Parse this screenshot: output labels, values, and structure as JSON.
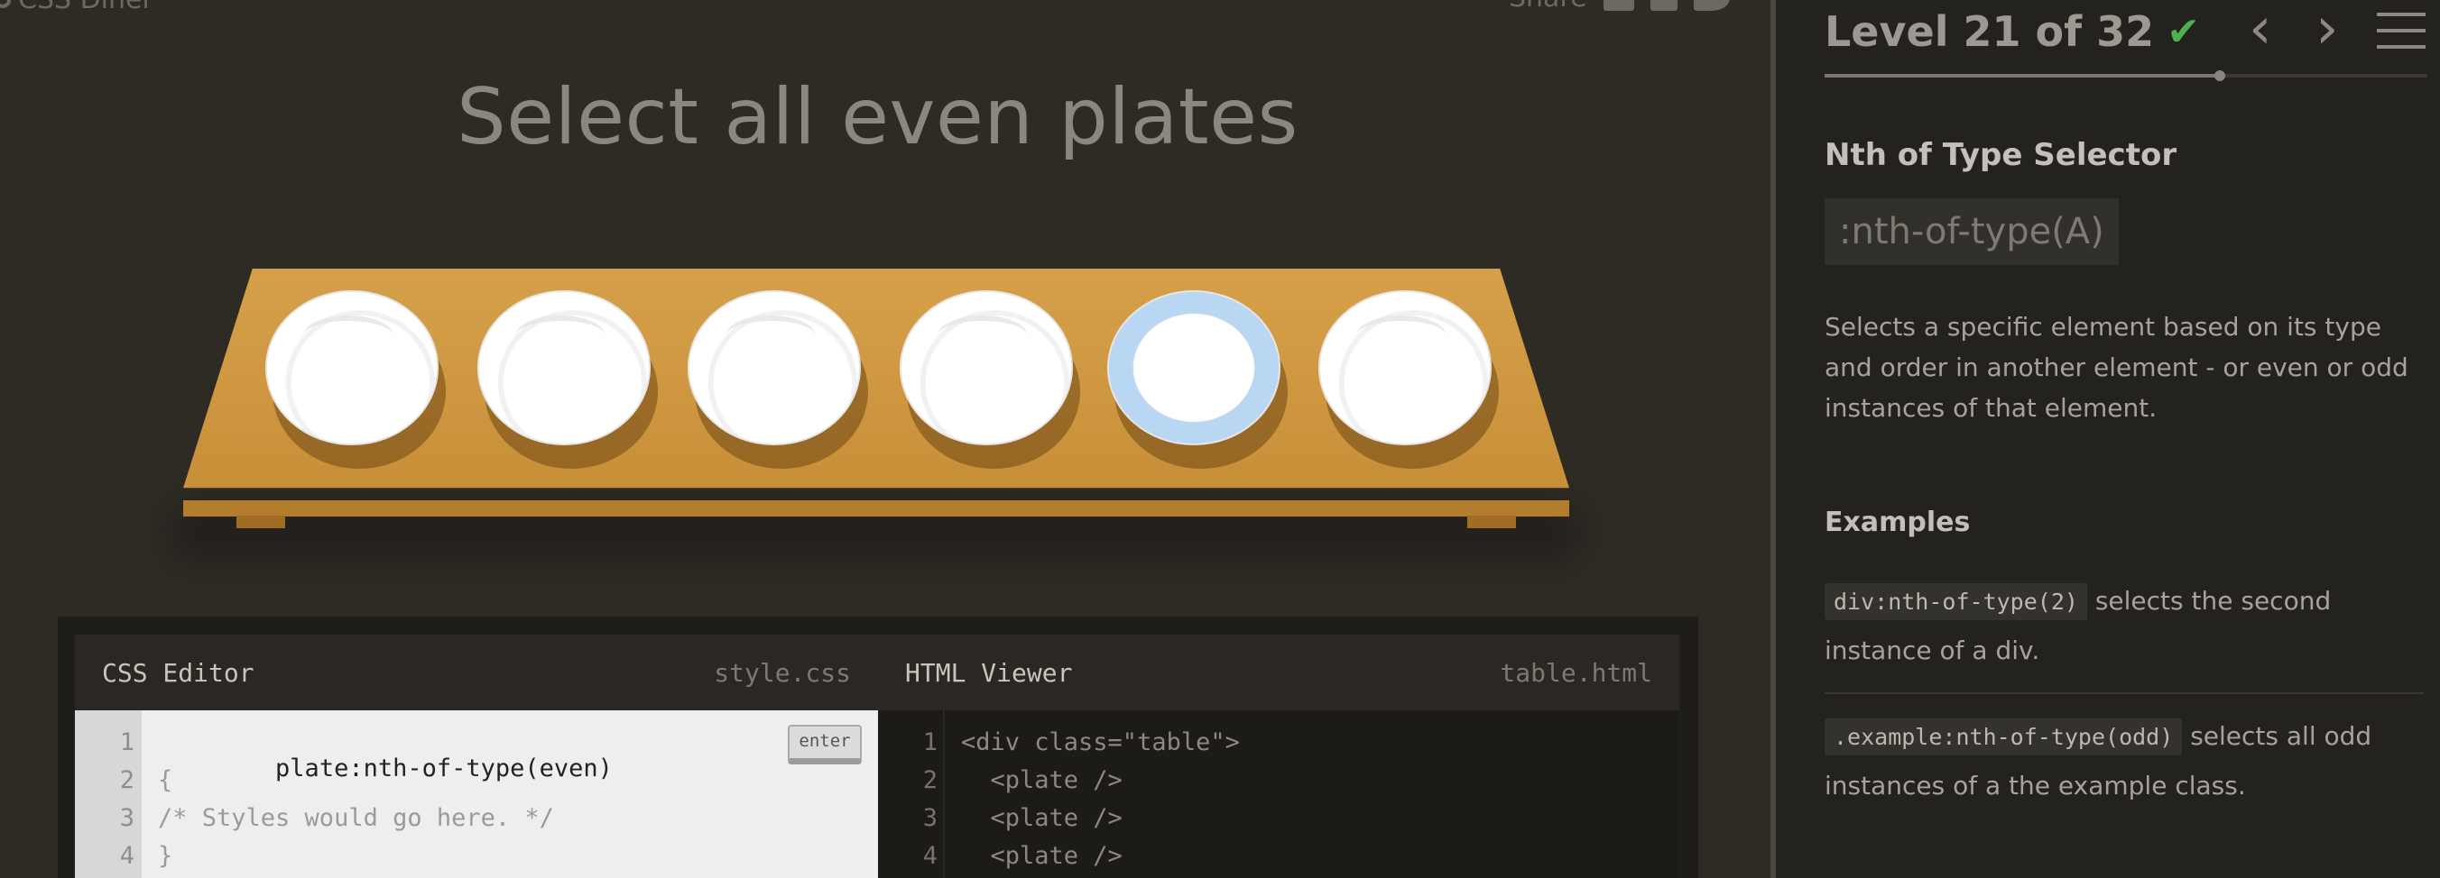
{
  "header": {
    "logo_text": "CSS Diner",
    "share_label": "Share"
  },
  "order": "Select all even plates",
  "table": {
    "plates": [
      {
        "selected": false
      },
      {
        "selected": false
      },
      {
        "selected": false
      },
      {
        "selected": false
      },
      {
        "selected": true
      },
      {
        "selected": false
      }
    ]
  },
  "css_editor": {
    "title": "CSS Editor",
    "file": "style.css",
    "line_numbers": [
      "1",
      "2",
      "3",
      "4"
    ],
    "input_value": "plate:nth-of-type(even)",
    "line2": "{",
    "line3": "/* Styles would go here. */",
    "line4": "}",
    "enter_label": "enter"
  },
  "html_viewer": {
    "title": "HTML Viewer",
    "file": "table.html",
    "line_numbers": [
      "1",
      "2",
      "3",
      "4"
    ],
    "lines": [
      "<div class=\"table\">",
      "  <plate />",
      "  <plate />",
      "  <plate />"
    ]
  },
  "sidebar": {
    "level_text": "Level 21 of 32",
    "progress_fraction": 0.656,
    "selector_name": "Nth of Type Selector",
    "syntax": ":nth-of-type(A)",
    "description": "Selects a specific element based on its type and order in another element - or even or odd instances of that element.",
    "examples_title": "Examples",
    "examples": [
      {
        "code": "div:nth-of-type(2)",
        "text": " selects the second instance of a div."
      },
      {
        "code": ".example:nth-of-type(odd)",
        "text": " selects all odd instances of a the example class."
      }
    ]
  },
  "colors": {
    "accent_check": "#4caf50",
    "selected_ring": "#b9d7f2",
    "table_wood": "#d6a04a"
  },
  "icons": [
    "check-icon",
    "prev-arrow-icon",
    "next-arrow-icon",
    "menu-icon",
    "mail-icon",
    "facebook-icon",
    "twitter-icon"
  ]
}
